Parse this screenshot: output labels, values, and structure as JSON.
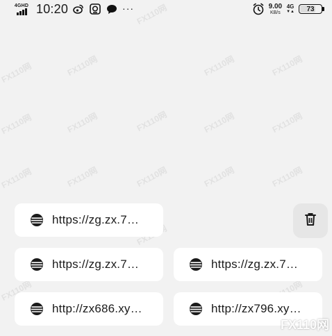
{
  "status_bar": {
    "network_label": "4GHD",
    "time": "10:20",
    "more": "···",
    "speed_value": "9.00",
    "speed_unit": "KB/s",
    "network2": "4G",
    "battery": "73"
  },
  "watermark_text": "FX110网",
  "corner_logo": "FX110网",
  "history": [
    {
      "text": "https://zg.zx.7…"
    },
    {
      "text": "https://zg.zx.7…"
    },
    {
      "text": "https://zg.zx.7…"
    },
    {
      "text": "http://zx686.xy…"
    },
    {
      "text": "http://zx796.xy…"
    }
  ],
  "icons": {
    "item": "globe-icon",
    "delete": "trash-icon"
  },
  "colors": {
    "background": "#f2f2f2",
    "chip": "#ffffff",
    "trash_bg": "#e6e6e6"
  }
}
